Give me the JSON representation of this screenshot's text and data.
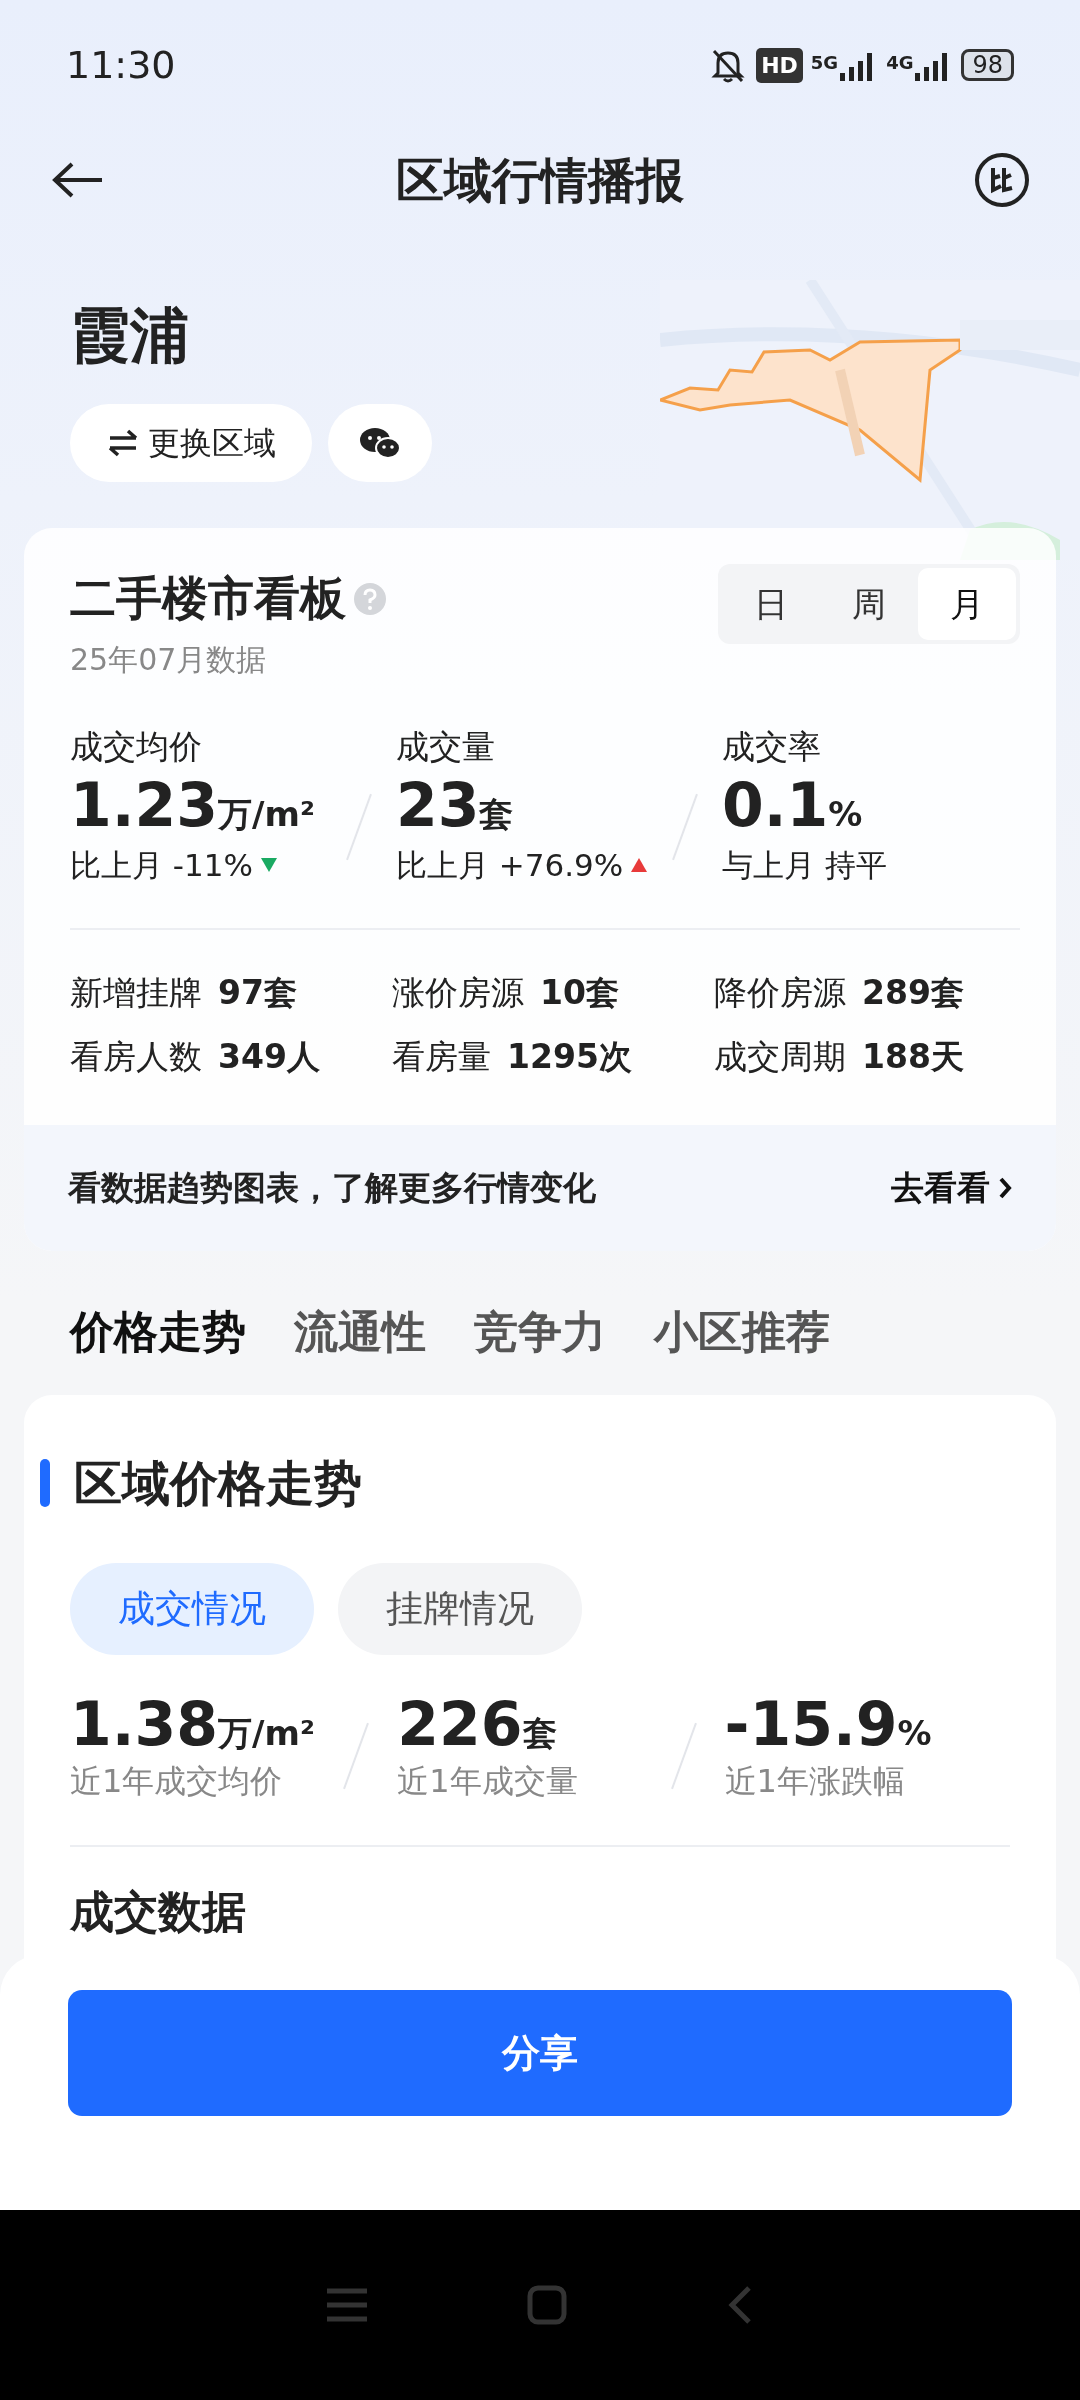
{
  "status_bar": {
    "time": "11:30",
    "hd": "HD",
    "network_1": "5G",
    "network_2": "4G",
    "battery": "98"
  },
  "header": {
    "title": "区域行情播报"
  },
  "region": {
    "name": "霞浦",
    "buttons": [
      {
        "kind": "change",
        "label": "更换区域"
      },
      {
        "kind": "wechat"
      }
    ]
  },
  "board": {
    "title": "二手楼市看板",
    "subtitle": "25年07月数据",
    "periods": [
      {
        "label": "日",
        "selected": false
      },
      {
        "label": "周",
        "selected": false
      },
      {
        "label": "月",
        "selected": true
      }
    ],
    "metrics": [
      {
        "label": "成交均价",
        "value": "1.23",
        "unit": "万/m²",
        "compare": "比上月 -11%",
        "kind": "down"
      },
      {
        "label": "成交量",
        "value": "23",
        "unit": "套",
        "compare": "比上月 +76.9%",
        "kind": "up"
      },
      {
        "label": "成交率",
        "value": "0.1",
        "unit": "%",
        "compare": "与上月 持平",
        "kind": "flat"
      }
    ],
    "stats": [
      {
        "label": "新增挂牌",
        "value": "97套"
      },
      {
        "label": "涨价房源",
        "value": "10套"
      },
      {
        "label": "降价房源",
        "value": "289套"
      },
      {
        "label": "看房人数",
        "value": "349人"
      },
      {
        "label": "看房量",
        "value": "1295次"
      },
      {
        "label": "成交周期",
        "value": "188天"
      }
    ],
    "banner": {
      "text": "看数据趋势图表，了解更多行情变化",
      "link": "去看看"
    }
  },
  "tabs": [
    {
      "label": "价格走势",
      "selected": true
    },
    {
      "label": "流通性",
      "selected": false
    },
    {
      "label": "竞争力",
      "selected": false
    },
    {
      "label": "小区推荐",
      "selected": false
    }
  ],
  "price_trend": {
    "title": "区域价格走势",
    "pills": [
      {
        "label": "成交情况",
        "selected": true
      },
      {
        "label": "挂牌情况",
        "selected": false
      }
    ],
    "metrics": [
      {
        "value": "1.38",
        "unit": "万/m²",
        "label": "近1年成交均价"
      },
      {
        "value": "226",
        "unit": "套",
        "label": "近1年成交量"
      },
      {
        "value": "-15.9",
        "unit": "%",
        "label": "近1年涨跌幅"
      }
    ],
    "section_title": "成交数据"
  },
  "share_button": "分享"
}
